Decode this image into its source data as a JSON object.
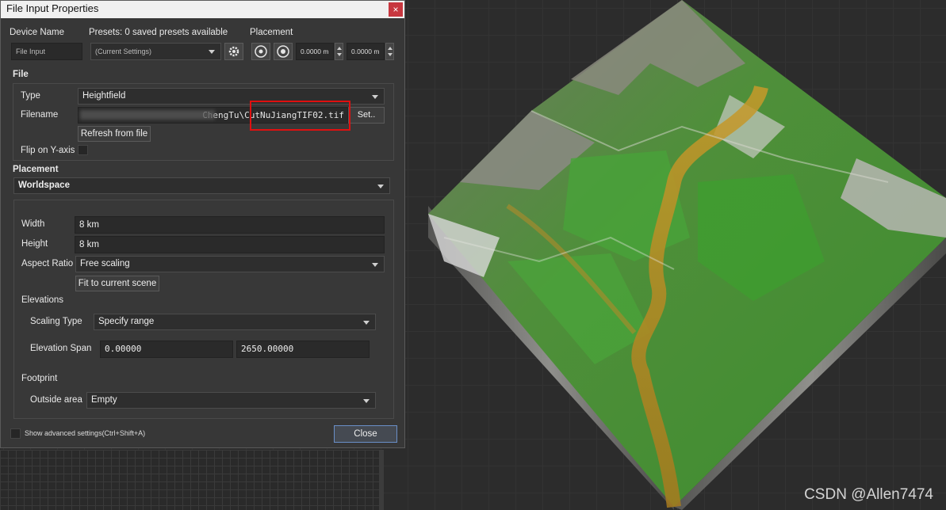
{
  "window": {
    "title": "File Input Properties",
    "close_glyph": "×"
  },
  "header": {
    "device_name_label": "Device Name",
    "device_name_value": "File Input",
    "presets_label": "Presets: 0 saved presets available",
    "presets_value": "(Current Settings)",
    "placement_label": "Placement",
    "placement_x": "0.0000 m",
    "placement_y": "0.0000 m"
  },
  "file": {
    "section_label": "File",
    "type_label": "Type",
    "type_value": "Heightfield",
    "filename_label": "Filename",
    "filename_visible": "ChengTu\\CutNuJiangTIF02.tif",
    "set_button": "Set..",
    "refresh_button": "Refresh from file",
    "flip_label": "Flip on Y-axis"
  },
  "placement": {
    "section_label": "Placement",
    "mode_value": "Worldspace",
    "width_label": "Width",
    "width_value": "8 km",
    "height_label": "Height",
    "height_value": "8 km",
    "aspect_label": "Aspect Ratio",
    "aspect_value": "Free scaling",
    "fit_button": "Fit to current scene",
    "elevations_label": "Elevations",
    "scaling_type_label": "Scaling Type",
    "scaling_type_value": "Specify range",
    "elevation_span_label": "Elevation Span",
    "elevation_min": "0.00000",
    "elevation_max": "2650.00000",
    "footprint_label": "Footprint",
    "outside_area_label": "Outside area",
    "outside_area_value": "Empty"
  },
  "footer": {
    "advanced_label": "Show advanced settings(Ctrl+Shift+A)",
    "close_button": "Close"
  },
  "watermark": "CSDN @Allen7474",
  "icons": {
    "placement_reset": "rotate-target-icon",
    "placement_center": "target-icon",
    "presets_settings": "gear-icon"
  }
}
